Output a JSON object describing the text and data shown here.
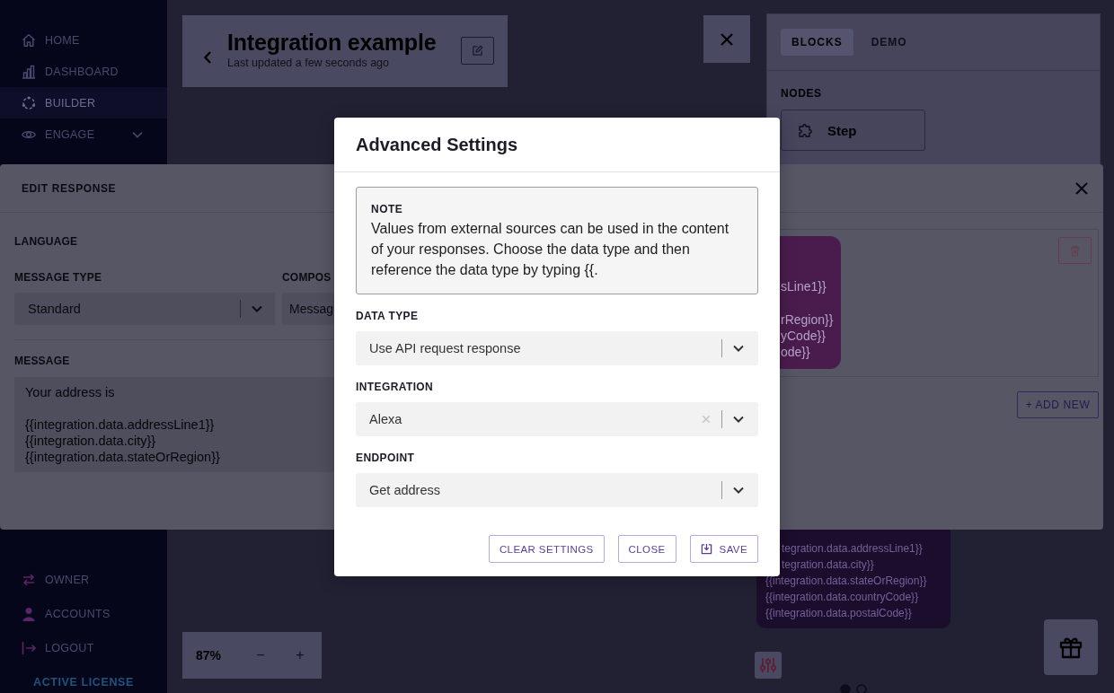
{
  "sidebar": {
    "items": [
      {
        "label": "HOME",
        "kind": "link",
        "selected": false
      },
      {
        "label": "DASHBOARD",
        "kind": "link",
        "selected": false
      },
      {
        "label": "BUILDER",
        "kind": "link",
        "selected": true
      },
      {
        "label": "ENGAGE",
        "kind": "group",
        "selected": false
      }
    ],
    "account_items": [
      {
        "label": "OWNER",
        "selected": false
      },
      {
        "label": "ACCOUNTS",
        "selected": false
      },
      {
        "label": "LOGOUT",
        "selected": false
      }
    ],
    "license": "ACTIVE LICENSE"
  },
  "header": {
    "title": "Integration example",
    "subtitle": "Last updated a few seconds ago"
  },
  "builder_panel": {
    "tabs": [
      {
        "label": "BLOCKS",
        "selected": true
      },
      {
        "label": "DEMO",
        "selected": false
      }
    ],
    "section_title": "NODES",
    "nodes": [
      {
        "label": "Step"
      }
    ]
  },
  "canvas": {
    "zoom": {
      "value": "87%",
      "decrease": "−",
      "increase": "+"
    },
    "message_node": {
      "lines": [
        {
          "text": "tegration.data.addressLine1}}",
          "kind": "cut"
        },
        {
          "text": "tegration.data.city}}",
          "kind": "cut"
        },
        {
          "text": "{{integration.data.stateOrRegion}}",
          "kind": "full"
        },
        {
          "text": "{{integration.data.countryCode}}",
          "kind": "full"
        },
        {
          "text": "{{integration.data.postalCode}}",
          "kind": "full"
        }
      ]
    },
    "pages": [
      {
        "selected": true
      },
      {
        "selected": false
      }
    ]
  },
  "edit_response": {
    "title": "EDIT RESPONSE",
    "language_label": "LANGUAGE",
    "message_type": {
      "label": "MESSAGE TYPE",
      "value": "Standard"
    },
    "composer": {
      "label": "COMPOS",
      "value": "Messag"
    },
    "message": {
      "label": "MESSAGE",
      "value": "Your address is\n\n{{integration.data.addressLine1}}\n{{integration.data.city}}\n{{integration.data.stateOrRegion}}"
    },
    "preview": {
      "text": "sLine1}}\n\nrRegion}}\nyCode}}\node}}"
    },
    "add_button": "+ ADD NEW"
  },
  "dialog": {
    "title": "Advanced Settings",
    "note": {
      "label": "NOTE",
      "text": "Values from external sources can be used in the content of your responses. Choose the data type and then reference the data type by typing {{."
    },
    "fields": [
      {
        "label": "DATA TYPE",
        "value": "Use API request response",
        "clearable": false
      },
      {
        "label": "INTEGRATION",
        "value": "Alexa",
        "clearable": true
      },
      {
        "label": "ENDPOINT",
        "value": "Get address",
        "clearable": false
      }
    ],
    "buttons": [
      {
        "label": "CLEAR SETTINGS",
        "kind": "text"
      },
      {
        "label": "CLOSE",
        "kind": "text"
      },
      {
        "label": "SAVE",
        "kind": "save"
      }
    ]
  }
}
